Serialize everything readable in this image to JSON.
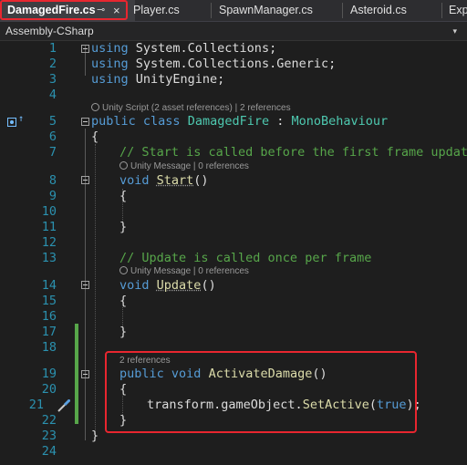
{
  "tabs": [
    {
      "label": "DamagedFire.cs",
      "active": true,
      "pin": "⊸",
      "close": "×"
    },
    {
      "label": "Player.cs"
    },
    {
      "label": "SpawnManager.cs"
    },
    {
      "label": "Asteroid.cs"
    },
    {
      "label": "Exp"
    }
  ],
  "navbar": {
    "project": "Assembly-CSharp",
    "arrow": "▾"
  },
  "line_numbers": [
    "1",
    "2",
    "3",
    "4",
    "5",
    "6",
    "7",
    "8",
    "9",
    "10",
    "11",
    "12",
    "13",
    "14",
    "15",
    "16",
    "17",
    "18",
    "19",
    "20",
    "21",
    "22",
    "23",
    "24"
  ],
  "code": {
    "l1_kw": "using",
    "l1_ns": " System.Collections;",
    "l2_kw": "using",
    "l2_ns": " System.Collections.Generic;",
    "l3_kw": "using",
    "l3_ns": " UnityEngine;",
    "lens_class": "Unity Script (2 asset references) | 2 references",
    "l5_kw1": "public",
    "l5_kw2": "class",
    "l5_name": "DamagedFire",
    "l5_colon": " : ",
    "l5_base": "MonoBehaviour",
    "l6": "{",
    "l7_comment": "// Start is called before the first frame update",
    "lens_start": "Unity Message | 0 references",
    "l8_kw": "void",
    "l8_name": "Start",
    "l8_parens": "()",
    "l9": "{",
    "l11": "}",
    "l13_comment": "// Update is called once per frame",
    "lens_update": "Unity Message | 0 references",
    "l14_kw": "void",
    "l14_name": "Update",
    "l14_parens": "()",
    "l15": "{",
    "l17": "}",
    "lens_activate": "2 references",
    "l19_kw1": "public",
    "l19_kw2": "void",
    "l19_name": "ActivateDamage",
    "l19_parens": "()",
    "l20": "{",
    "l21_obj": "transform.gameObject.",
    "l21_method": "SetActive",
    "l21_open": "(",
    "l21_arg": "true",
    "l21_close": ");",
    "l22": "}",
    "l23": "}"
  },
  "colors": {
    "keyword": "#569cd6",
    "type": "#4ec9b0",
    "comment": "#57a64a",
    "method": "#dcdcaa",
    "line_number": "#2b91af",
    "callout": "#e8262f"
  }
}
